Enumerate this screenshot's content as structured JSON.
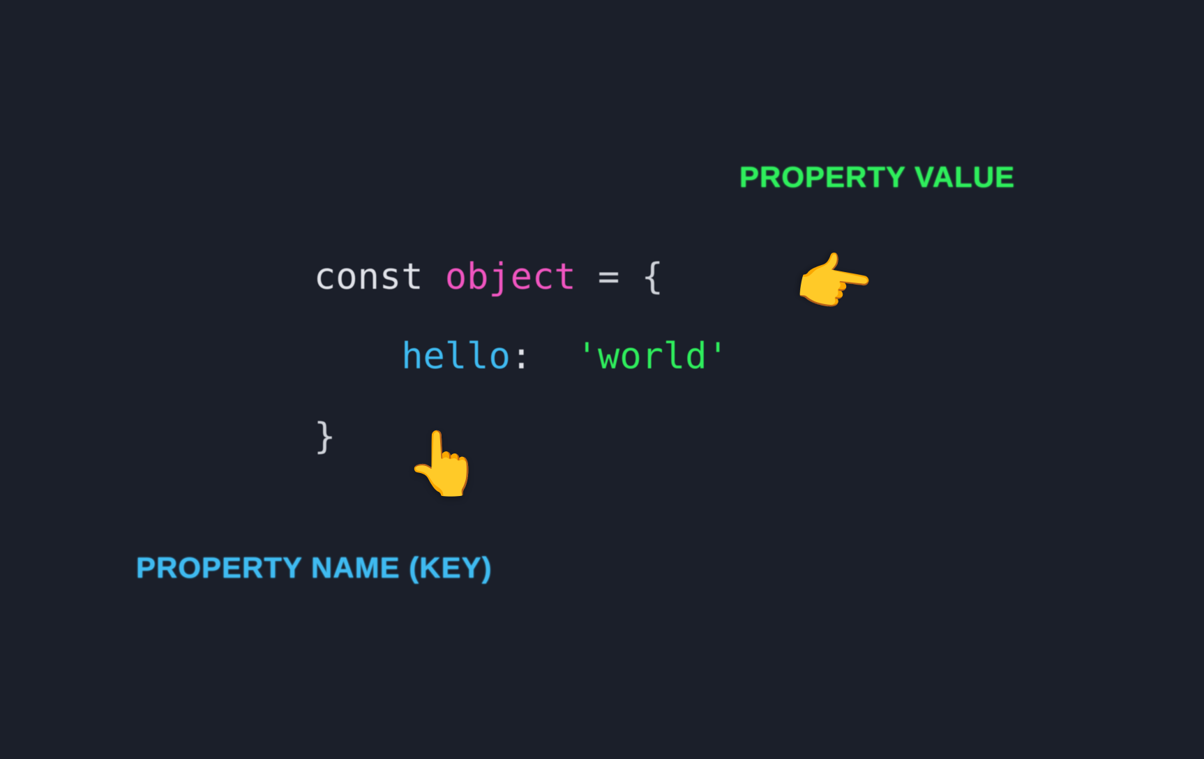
{
  "labels": {
    "property_value": "PROPERTY VALUE",
    "property_key": "PROPERTY NAME (KEY)"
  },
  "code": {
    "const": "const ",
    "object": "object",
    "equals_open": " = {",
    "indent": "    ",
    "key": "hello",
    "colon_gap": ":  ",
    "value": "'world'",
    "close": "}"
  },
  "icons": {
    "point_value": "👆",
    "point_key": "👆"
  }
}
